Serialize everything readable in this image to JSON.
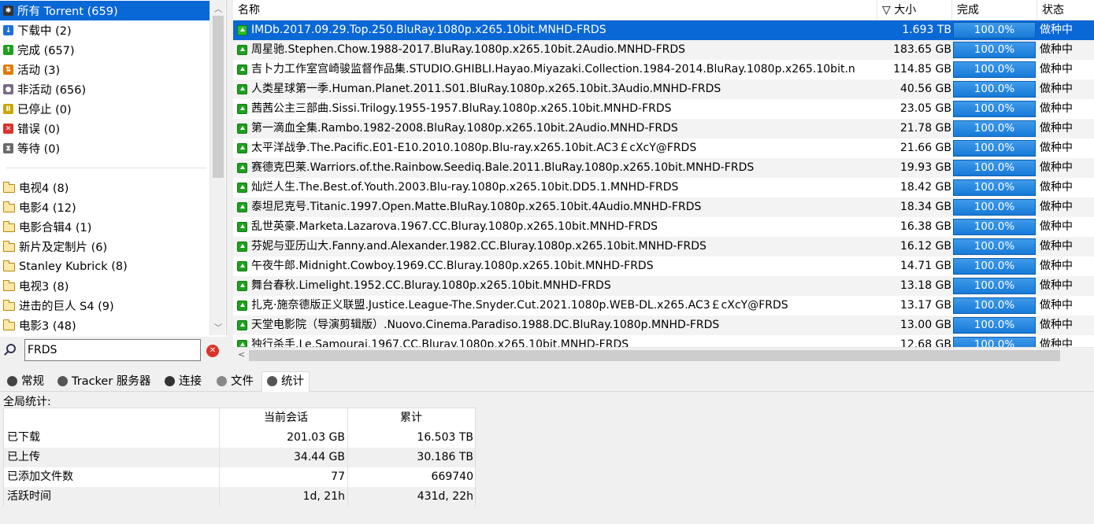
{
  "sidebar": {
    "status_items": [
      {
        "label": "所有 Torrent (659)",
        "icon": "all-torrents-icon",
        "color": "#333333",
        "glyph": "✱"
      },
      {
        "label": "下载中 (2)",
        "icon": "downloading-icon",
        "color": "#1e6fd9",
        "glyph": "↓"
      },
      {
        "label": "完成 (657)",
        "icon": "completed-icon",
        "color": "#20a020",
        "glyph": "↑"
      },
      {
        "label": "活动 (3)",
        "icon": "active-icon",
        "color": "#e07b00",
        "glyph": "⇅"
      },
      {
        "label": "非活动 (656)",
        "icon": "inactive-icon",
        "color": "#7a6a8a",
        "glyph": "●"
      },
      {
        "label": "已停止 (0)",
        "icon": "paused-icon",
        "color": "#c9a800",
        "glyph": "Ⅱ"
      },
      {
        "label": "错误 (0)",
        "icon": "error-icon",
        "color": "#d9342b",
        "glyph": "✕"
      },
      {
        "label": "等待 (0)",
        "icon": "queued-icon",
        "color": "#6a6a6a",
        "glyph": "⧗"
      }
    ],
    "category_items": [
      {
        "label": "电视4 (8)"
      },
      {
        "label": "电影4 (12)"
      },
      {
        "label": "电影合辑4 (1)"
      },
      {
        "label": "新片及定制片 (6)"
      },
      {
        "label": "Stanley Kubrick (8)"
      },
      {
        "label": "电视3 (8)"
      },
      {
        "label": "进击的巨人 S4 (9)"
      },
      {
        "label": "电影3 (48)"
      }
    ]
  },
  "search": {
    "value": "FRDS"
  },
  "list": {
    "columns": {
      "name": "名称",
      "size": "▽ 大小",
      "done": "完成",
      "state": "状态"
    },
    "rows": [
      {
        "name": "IMDb.2017.09.29.Top.250.BluRay.1080p.x265.10bit.MNHD-FRDS",
        "size": "1.693 TB",
        "done": "100.0%",
        "state": "做种中"
      },
      {
        "name": "周星驰.Stephen.Chow.1988-2017.BluRay.1080p.x265.10bit.2Audio.MNHD-FRDS",
        "size": "183.65 GB",
        "done": "100.0%",
        "state": "做种中"
      },
      {
        "name": "吉卜力工作室宫崎骏监督作品集.STUDIO.GHIBLI.Hayao.Miyazaki.Collection.1984-2014.BluRay.1080p.x265.10bit.n",
        "size": "114.85 GB",
        "done": "100.0%",
        "state": "做种中"
      },
      {
        "name": "人类星球第一季.Human.Planet.2011.S01.BluRay.1080p.x265.10bit.3Audio.MNHD-FRDS",
        "size": "40.56 GB",
        "done": "100.0%",
        "state": "做种中"
      },
      {
        "name": "茜茜公主三部曲.Sissi.Trilogy.1955-1957.BluRay.1080p.x265.10bit.MNHD-FRDS",
        "size": "23.05 GB",
        "done": "100.0%",
        "state": "做种中"
      },
      {
        "name": "第一滴血全集.Rambo.1982-2008.BluRay.1080p.x265.10bit.2Audio.MNHD-FRDS",
        "size": "21.78 GB",
        "done": "100.0%",
        "state": "做种中"
      },
      {
        "name": "太平洋战争.The.Pacific.E01-E10.2010.1080p.Blu-ray.x265.10bit.AC3￡cXcY@FRDS",
        "size": "21.66 GB",
        "done": "100.0%",
        "state": "做种中"
      },
      {
        "name": "赛德克巴莱.Warriors.of.the.Rainbow.Seediq.Bale.2011.BluRay.1080p.x265.10bit.MNHD-FRDS",
        "size": "19.93 GB",
        "done": "100.0%",
        "state": "做种中"
      },
      {
        "name": "灿烂人生.The.Best.of.Youth.2003.Blu-ray.1080p.x265.10bit.DD5.1.MNHD-FRDS",
        "size": "18.42 GB",
        "done": "100.0%",
        "state": "做种中"
      },
      {
        "name": "泰坦尼克号.Titanic.1997.Open.Matte.BluRay.1080p.x265.10bit.4Audio.MNHD-FRDS",
        "size": "18.34 GB",
        "done": "100.0%",
        "state": "做种中"
      },
      {
        "name": "乱世英豪.Marketa.Lazarova.1967.CC.Bluray.1080p.x265.10bit.MNHD-FRDS",
        "size": "16.38 GB",
        "done": "100.0%",
        "state": "做种中"
      },
      {
        "name": "芬妮与亚历山大.Fanny.and.Alexander.1982.CC.Bluray.1080p.x265.10bit.MNHD-FRDS",
        "size": "16.12 GB",
        "done": "100.0%",
        "state": "做种中"
      },
      {
        "name": "午夜牛郎.Midnight.Cowboy.1969.CC.Bluray.1080p.x265.10bit.MNHD-FRDS",
        "size": "14.71 GB",
        "done": "100.0%",
        "state": "做种中"
      },
      {
        "name": "舞台春秋.Limelight.1952.CC.Bluray.1080p.x265.10bit.MNHD-FRDS",
        "size": "13.18 GB",
        "done": "100.0%",
        "state": "做种中"
      },
      {
        "name": "扎克·施奈德版正义联盟.Justice.League-The.Snyder.Cut.2021.1080p.WEB-DL.x265.AC3￡cXcY@FRDS",
        "size": "13.17 GB",
        "done": "100.0%",
        "state": "做种中"
      },
      {
        "name": "天堂电影院（导演剪辑版）.Nuovo.Cinema.Paradiso.1988.DC.BluRay.1080p.MNHD-FRDS",
        "size": "13.00 GB",
        "done": "100.0%",
        "state": "做种中"
      },
      {
        "name": "独行杀手.Le.Samourai.1967.CC.Bluray.1080p.x265.10bit.MNHD-FRDS",
        "size": "12.68 GB",
        "done": "100.0%",
        "state": "做种中"
      }
    ]
  },
  "tabs": [
    {
      "label": "常规",
      "icon": "general-icon"
    },
    {
      "label": "Tracker 服务器",
      "icon": "tracker-icon"
    },
    {
      "label": "连接",
      "icon": "peers-icon"
    },
    {
      "label": "文件",
      "icon": "files-icon"
    },
    {
      "label": "统计",
      "icon": "statistics-icon"
    }
  ],
  "stats": {
    "title": "全局统计:",
    "col_session": "当前会话",
    "col_total": "累计",
    "rows": [
      {
        "label": "已下载",
        "session": "201.03 GB",
        "total": "16.503 TB"
      },
      {
        "label": "已上传",
        "session": "34.44 GB",
        "total": "30.186 TB"
      },
      {
        "label": "已添加文件数",
        "session": "77",
        "total": "669740"
      },
      {
        "label": "活跃时间",
        "session": "1d, 21h",
        "total": "431d, 22h"
      }
    ]
  },
  "colors": {
    "selection": "#0a67d6",
    "progress": "#167ad8",
    "seeding_icon": "#20a020"
  }
}
